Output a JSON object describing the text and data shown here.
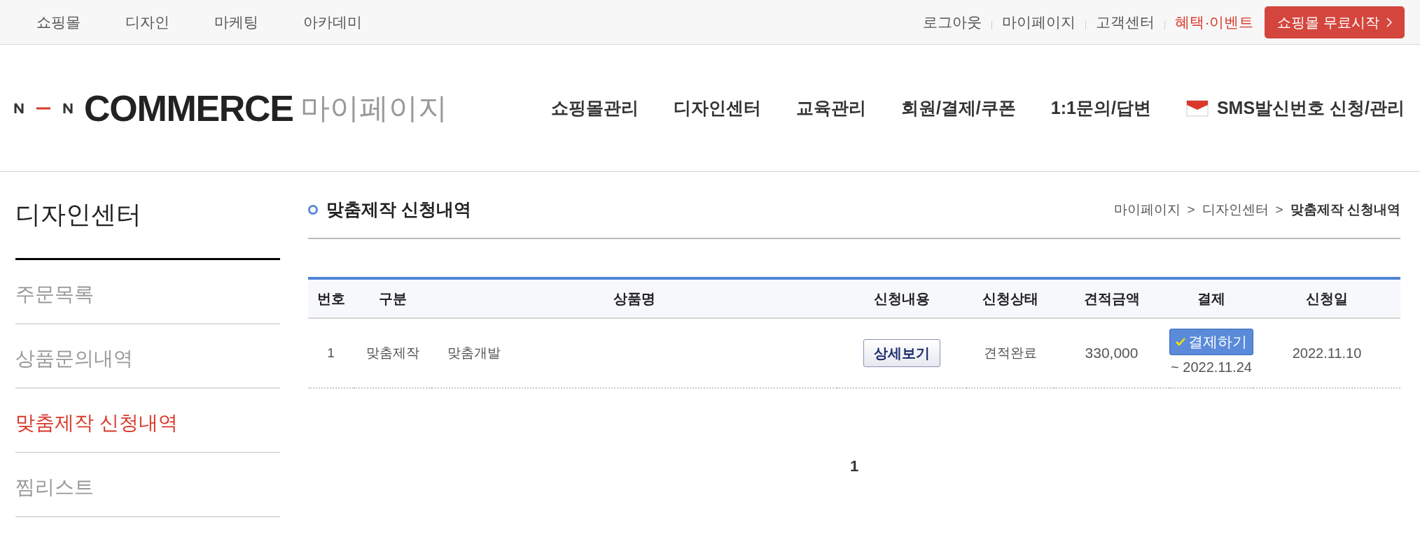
{
  "top_bar": {
    "left_links": [
      "쇼핑몰",
      "디자인",
      "마케팅",
      "아카데미"
    ],
    "right_links": [
      {
        "label": "로그아웃",
        "highlighted": false
      },
      {
        "label": "마이페이지",
        "highlighted": false
      },
      {
        "label": "고객센터",
        "highlighted": false
      },
      {
        "label": "혜택·이벤트",
        "highlighted": true
      }
    ],
    "cta_button": "쇼핑몰 무료시작"
  },
  "header": {
    "logo_text": "COMMERCE",
    "logo_subtitle": "마이페이지",
    "nav": [
      {
        "label": "쇼핑몰관리",
        "icon": false
      },
      {
        "label": "디자인센터",
        "icon": false
      },
      {
        "label": "교육관리",
        "icon": false
      },
      {
        "label": "회원/결제/쿠폰",
        "icon": false
      },
      {
        "label": "1:1문의/답변",
        "icon": false
      },
      {
        "label": "SMS발신번호 신청/관리",
        "icon": true
      }
    ]
  },
  "sidebar": {
    "title": "디자인센터",
    "items": [
      {
        "label": "주문목록",
        "selected": false
      },
      {
        "label": "상품문의내역",
        "selected": false
      },
      {
        "label": "맞춤제작 신청내역",
        "selected": true
      },
      {
        "label": "찜리스트",
        "selected": false
      }
    ]
  },
  "main": {
    "title": "맞춤제작 신청내역",
    "breadcrumb": [
      {
        "label": "마이페이지",
        "current": false
      },
      {
        "label": "디자인센터",
        "current": false
      },
      {
        "label": "맞춤제작 신청내역",
        "current": true
      }
    ],
    "breadcrumb_separator": ">",
    "table": {
      "columns": [
        "번호",
        "구분",
        "상품명",
        "신청내용",
        "신청상태",
        "견적금액",
        "결제",
        "신청일"
      ],
      "rows": [
        {
          "number": "1",
          "category": "맞춤제작",
          "product": "맞춤개발",
          "detail_button": "상세보기",
          "status": "견적완료",
          "amount": "330,000",
          "pay_button": "결제하기",
          "pay_deadline": "~ 2022.11.24",
          "date": "2022.11.10"
        }
      ]
    },
    "pagination": [
      {
        "label": "1",
        "selected": true
      }
    ]
  }
}
